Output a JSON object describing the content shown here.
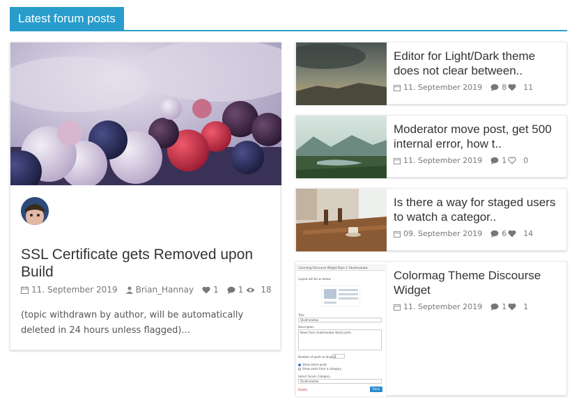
{
  "section": {
    "title": "Latest forum posts"
  },
  "featured": {
    "title": "SSL Certificate gets Removed upon Build",
    "date": "11. September 2019",
    "author": "Brian_Hannay",
    "likes": "1",
    "replies": "1",
    "views": "18",
    "excerpt": "(topic withdrawn by author, will be automatically deleted in 24 hours unless flagged)..."
  },
  "posts": [
    {
      "title": "Editor for Light/Dark theme does not clear between..",
      "date": "11. September 2019",
      "replies": "8",
      "likes": "11",
      "liked": true
    },
    {
      "title": "Moderator move post, get 500 internal error, how t..",
      "date": "11. September 2019",
      "replies": "1",
      "likes": "0",
      "liked": false
    },
    {
      "title": "Is there a way for staged users to watch a categor..",
      "date": "09. September 2019",
      "replies": "6",
      "likes": "14",
      "liked": true
    },
    {
      "title": "Colormag Theme Discourse Widget",
      "date": "11. September 2019",
      "replies": "1",
      "likes": "1",
      "liked": true
    }
  ],
  "widget_screenshot": {
    "heading": "Colormag Discourse Widget Style 1: Studmeadow",
    "layout_label": "Layout will be as below",
    "title_label": "Title",
    "title_value": "Studmeadow",
    "description_label": "Description",
    "description_value": "News from studmeadow latest posts",
    "count_label": "Number of posts to display:",
    "count_value": "5",
    "radio_latest": "Show latest posts",
    "radio_category": "Show posts from a category",
    "category_label": "Select Forum Category",
    "category_value": "Studmeadow",
    "delete_link": "Delete",
    "done_button": "Done"
  },
  "colors": {
    "accent": "#289dcc",
    "text": "#333333",
    "meta": "#777777"
  }
}
